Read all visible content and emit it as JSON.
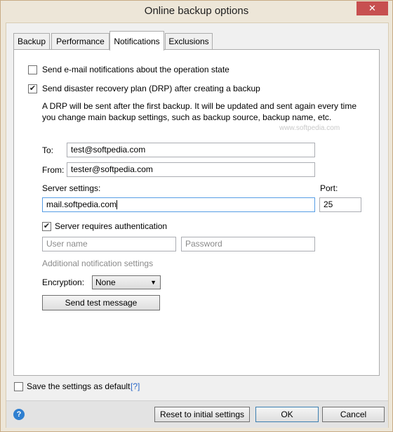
{
  "window": {
    "title": "Online backup options",
    "close_glyph": "✕"
  },
  "tabs": [
    {
      "label": "Backup"
    },
    {
      "label": "Performance"
    },
    {
      "label": "Notifications"
    },
    {
      "label": "Exclusions"
    }
  ],
  "notifications": {
    "email_state_label": "Send e-mail notifications about the operation state",
    "email_state_checked": false,
    "drp_label": "Send disaster recovery plan (DRP) after creating a backup",
    "drp_checked": true,
    "drp_description_line1": "A DRP will be sent after the first backup. It will be updated and sent again every time",
    "drp_description_line2": "you change main backup settings, such as backup source, backup name, etc.",
    "watermark": "www.softpedia.com",
    "to_label": "To:",
    "to_value": "test@softpedia.com",
    "from_label": "From:",
    "from_value": "tester@softpedia.com",
    "server_settings_label": "Server settings:",
    "server_value": "mail.softpedia.com",
    "port_label": "Port:",
    "port_value": "25",
    "auth_label": "Server requires authentication",
    "auth_checked": true,
    "username_placeholder": "User name",
    "password_placeholder": "Password",
    "additional_label": "Additional notification settings",
    "encryption_label": "Encryption:",
    "encryption_value": "None",
    "send_test_label": "Send test message"
  },
  "footer": {
    "save_default_label": "Save the settings as default",
    "save_default_checked": false,
    "help_link": "[?]",
    "help_icon_glyph": "?",
    "reset_label": "Reset to initial settings",
    "ok_label": "OK",
    "cancel_label": "Cancel"
  },
  "icons": {
    "close": "close-icon",
    "help": "help-icon",
    "dropdown": "chevron-down-icon",
    "check": "checkmark-icon"
  },
  "colors": {
    "title_bar": "#ede6d8",
    "close_button": "#c75050",
    "panel": "#ffffff",
    "link": "#2a67c7",
    "help_icon": "#2f7fd0"
  }
}
